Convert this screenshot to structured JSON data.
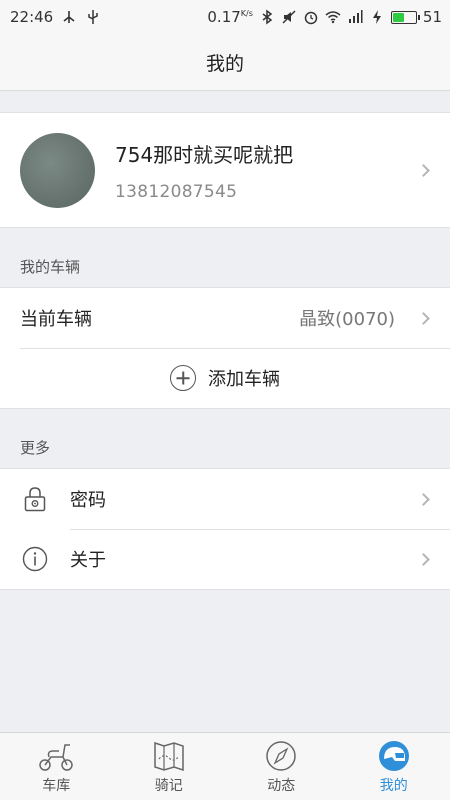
{
  "status_bar": {
    "time": "22:46",
    "speed": "0.17",
    "speed_unit": "K/s",
    "battery": "51",
    "network": "4G"
  },
  "header": {
    "title": "我的"
  },
  "profile": {
    "name": "754那时就买呢就把",
    "phone": "13812087545"
  },
  "vehicles": {
    "section_label": "我的车辆",
    "current_label": "当前车辆",
    "current_value": "晶致(0070)",
    "add_label": "添加车辆"
  },
  "more": {
    "section_label": "更多",
    "items": [
      {
        "label": "密码",
        "icon": "lock-icon"
      },
      {
        "label": "关于",
        "icon": "info-icon"
      }
    ]
  },
  "tabbar": {
    "items": [
      {
        "label": "车库",
        "icon": "scooter-icon"
      },
      {
        "label": "骑记",
        "icon": "map-icon"
      },
      {
        "label": "动态",
        "icon": "compass-icon"
      },
      {
        "label": "我的",
        "icon": "helmet-icon",
        "active": true
      }
    ],
    "active_color": "#2f8fd8"
  }
}
